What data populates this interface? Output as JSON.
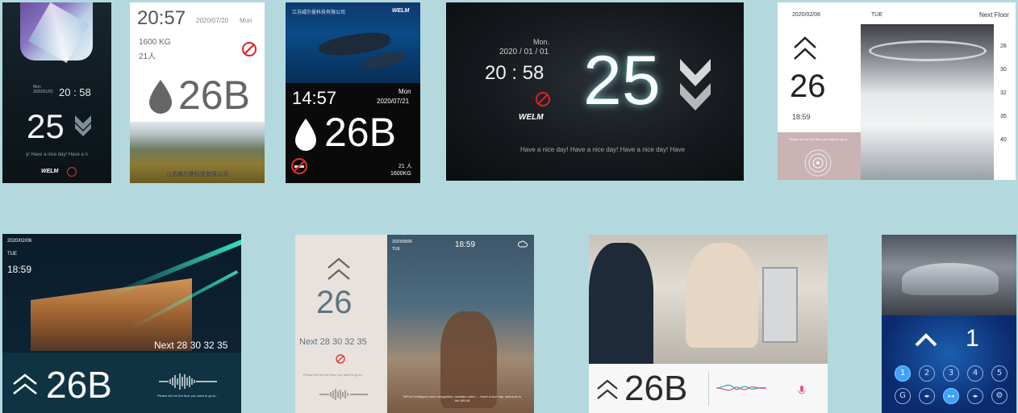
{
  "colors": {
    "background": "#b3d9df",
    "accent_cyan": "#3fe0d0",
    "key_active": "#3fa0ff"
  },
  "screen1": {
    "date_line": "Mon\n2020/01/01",
    "time": "20 : 58",
    "floor": "25",
    "ticker": "y! Have a nice day! Have a n",
    "brand": "WELM"
  },
  "screen2": {
    "time": "20:57",
    "date": "2020/07/20",
    "day": "Mon",
    "capacity": "1600 KG",
    "persons": "21人",
    "floor": "26B",
    "company": "江苏威尔曼科技有限公司"
  },
  "screen3": {
    "company": "江苏威尔曼科技有限公司",
    "brand": "WELM",
    "time": "14:57",
    "day": "Mon",
    "date": "2020/07/21",
    "floor": "26B",
    "persons": "21 人",
    "capacity": "1600KG"
  },
  "screen4": {
    "day": "Mon.",
    "date": "2020 / 01 / 01",
    "time": "20 : 58",
    "floor": "25",
    "brand": "WELM",
    "ticker": "Have a nice day! Have a nice day! Have a nice day! Have"
  },
  "screen5": {
    "date": "2020/02/06",
    "day": "TUE",
    "next_label": "Next Floor",
    "floor": "26",
    "time": "18:59",
    "next_floors": [
      "28",
      "30",
      "32",
      "35",
      "40"
    ],
    "prompt": "Please tell me the floor you want to go to..."
  },
  "screen6": {
    "date": "2020/02/06",
    "day": "TUE",
    "time": "18:59",
    "next_line": "Next 28 30 32 35",
    "floor": "26B",
    "prompt": "Please tell me the floor you want to go to..."
  },
  "screen7": {
    "floor": "26",
    "next_line": "Next 28 30 32 35",
    "prompt": "Please tell me the floor you want to go to...",
    "date": "2020/08/06",
    "day": "TUE",
    "time": "18:59",
    "notice": "WELM Intelligent voice recognition, maintain order, ... Have a nice day, welcome to the WELM"
  },
  "screen8": {
    "floor": "26B"
  },
  "screen9": {
    "floor": "1",
    "keys": [
      "1",
      "2",
      "3",
      "4",
      "5",
      "G",
      "◂▸",
      "▸◂",
      "◂▸",
      "⚙"
    ]
  }
}
